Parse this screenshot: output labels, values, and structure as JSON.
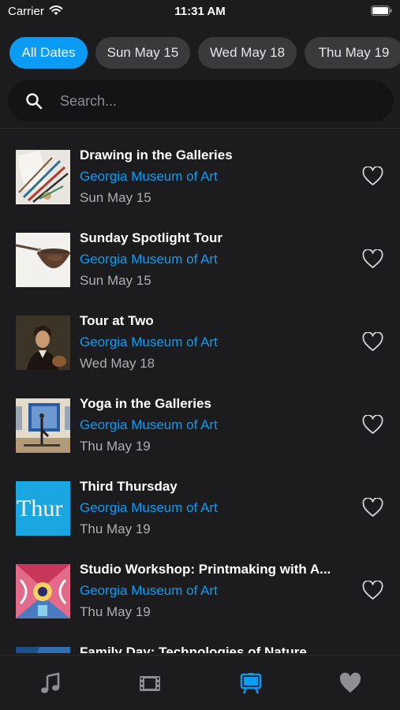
{
  "status_bar": {
    "carrier": "Carrier",
    "time": "11:31 AM"
  },
  "filters": {
    "chips": [
      {
        "label": "All Dates",
        "active": true
      },
      {
        "label": "Sun May 15",
        "active": false
      },
      {
        "label": "Wed May 18",
        "active": false
      },
      {
        "label": "Thu May 19",
        "active": false
      }
    ]
  },
  "search": {
    "placeholder": "Search..."
  },
  "events": [
    {
      "title": "Drawing in the Galleries",
      "venue": "Georgia Museum of Art",
      "date": "Sun May 15",
      "thumbnail": "pencils-drawing-image"
    },
    {
      "title": "Sunday Spotlight Tour",
      "venue": "Georgia Museum of Art",
      "date": "Sun May 15",
      "thumbnail": "bowl-object-image"
    },
    {
      "title": "Tour at Two",
      "venue": "Georgia Museum of Art",
      "date": "Wed May 18",
      "thumbnail": "portrait-painting-image"
    },
    {
      "title": "Yoga in the Galleries",
      "venue": "Georgia Museum of Art",
      "date": "Thu May 19",
      "thumbnail": "yoga-gallery-image"
    },
    {
      "title": "Third Thursday",
      "venue": "Georgia Museum of Art",
      "date": "Thu May 19",
      "thumbnail": "third-thursday-logo",
      "thumbnail_text": "Thur"
    },
    {
      "title": "Studio Workshop: Printmaking with A...",
      "venue": "Georgia Museum of Art",
      "date": "Thu May 19",
      "thumbnail": "printmaking-art-image"
    },
    {
      "title": "Family Day: Technologies of Nature",
      "venue": "",
      "date": "",
      "thumbnail": "nature-image"
    }
  ],
  "tabbar": {
    "tabs": [
      {
        "icon": "music-note-icon",
        "active": false
      },
      {
        "icon": "film-icon",
        "active": false
      },
      {
        "icon": "easel-icon",
        "active": true
      },
      {
        "icon": "heart-filled-icon",
        "active": false
      }
    ]
  },
  "colors": {
    "accent": "#0a9cf5",
    "background": "#1c1c1e",
    "chip": "#3a3a3c",
    "secondary_text": "#aeaeb2"
  }
}
